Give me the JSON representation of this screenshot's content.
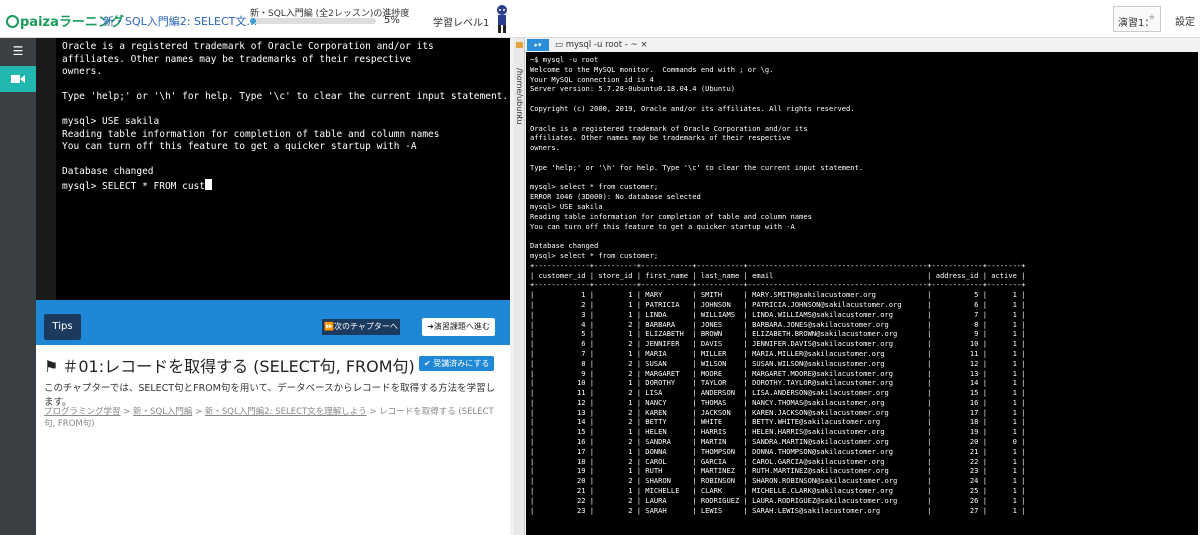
{
  "header": {
    "logo_text": "paizaラーニング",
    "course": "新・SQL入門編2: SELECT文…",
    "progress_label": "新・SQL入門編 (全2レッスン)の進捗度",
    "progress_percent": 5,
    "progress_text": "5%",
    "level_label": "学習レベル1",
    "exercise_button": "演習1：",
    "settings_label": "設定",
    "colors": {
      "accent": "#1e88d6",
      "logo": "#1a9c5b",
      "sidebar": "#3a3f44",
      "active": "#22b8b0"
    }
  },
  "sidebar": {
    "items": [
      {
        "icon": "menu-icon"
      },
      {
        "icon": "video-icon"
      }
    ]
  },
  "left_terminal": {
    "lines": [
      "Oracle is a registered trademark of Oracle Corporation and/or its",
      "affiliates. Other names may be trademarks of their respective",
      "owners.",
      "",
      "Type 'help;' or '\\h' for help. Type '\\c' to clear the current input statement.",
      "",
      "mysql> USE sakila",
      "Reading table information for completion of table and column names",
      "You can turn off this feature to get a quicker startup with -A",
      "",
      "Database changed"
    ],
    "prompt_line": "mysql> SELECT * FROM cust"
  },
  "tips": {
    "tips_label": "Tips",
    "next_chapter": "次のチャプターへ",
    "to_exercise": "演習課題へ進む"
  },
  "chapter": {
    "title": "＃01:レコードを取得する (SELECT句, FROM句)",
    "done_badge": "受講済みにする",
    "description": "このチャプターでは、SELECT句とFROM句を用いて、データベースからレコードを取得する方法を学習します。",
    "breadcrumb": [
      {
        "text": "プログラミング学習",
        "link": true
      },
      {
        "text": "新・SQL入門編",
        "link": true
      },
      {
        "text": "新・SQL入門編2: SELECT文を理解しよう",
        "link": true
      },
      {
        "text": "レコードを取得する (SELECT句, FROM句)",
        "link": false
      }
    ],
    "breadcrumb_separator": ">"
  },
  "right_pane": {
    "vertical_tab": "/home/ubuntu",
    "vertical_tab_close": "×",
    "tab_title": "mysql -u root - ~",
    "tab_close": "×",
    "terminal_lines": [
      "~$ mysql -u root",
      "Welcome to the MySQL monitor.  Commands end with ; or \\g.",
      "Your MySQL connection id is 4",
      "Server version: 5.7.28-0ubuntu0.18.04.4 (Ubuntu)",
      "",
      "Copyright (c) 2000, 2019, Oracle and/or its affiliates. All rights reserved.",
      "",
      "Oracle is a registered trademark of Oracle Corporation and/or its",
      "affiliates. Other names may be trademarks of their respective",
      "owners.",
      "",
      "Type 'help;' or '\\h' for help. Type '\\c' to clear the current input statement.",
      "",
      "mysql> select * from customer;",
      "ERROR 1046 (3D000): No database selected",
      "mysql> USE sakila",
      "Reading table information for completion of table and column names",
      "You can turn off this feature to get a quicker startup with -A",
      "",
      "Database changed",
      "mysql> select * from customer;",
      "+-------------+----------+------------+-----------+------------------------------------------+------------+--------+",
      "| customer_id | store_id | first_name | last_name | email                                    | address_id | active |",
      "+-------------+----------+------------+-----------+------------------------------------------+------------+--------+",
      "|           1 |        1 | MARY       | SMITH     | MARY.SMITH@sakilacustomer.org            |          5 |      1 |",
      "|           2 |        1 | PATRICIA   | JOHNSON   | PATRICIA.JOHNSON@sakilacustomer.org      |          6 |      1 |",
      "|           3 |        1 | LINDA      | WILLIAMS  | LINDA.WILLIAMS@sakilacustomer.org        |          7 |      1 |",
      "|           4 |        2 | BARBARA    | JONES     | BARBARA.JONES@sakilacustomer.org         |          8 |      1 |",
      "|           5 |        1 | ELIZABETH  | BROWN     | ELIZABETH.BROWN@sakilacustomer.org       |          9 |      1 |",
      "|           6 |        2 | JENNIFER   | DAVIS     | JENNIFER.DAVIS@sakilacustomer.org        |         10 |      1 |",
      "|           7 |        1 | MARIA      | MILLER    | MARIA.MILLER@sakilacustomer.org          |         11 |      1 |",
      "|           8 |        2 | SUSAN      | WILSON    | SUSAN.WILSON@sakilacustomer.org          |         12 |      1 |",
      "|           9 |        2 | MARGARET   | MOORE     | MARGARET.MOORE@sakilacustomer.org        |         13 |      1 |",
      "|          10 |        1 | DOROTHY    | TAYLOR    | DOROTHY.TAYLOR@sakilacustomer.org        |         14 |      1 |",
      "|          11 |        2 | LISA       | ANDERSON  | LISA.ANDERSON@sakilacustomer.org         |         15 |      1 |",
      "|          12 |        1 | NANCY      | THOMAS    | NANCY.THOMAS@sakilacustomer.org          |         16 |      1 |",
      "|          13 |        2 | KAREN      | JACKSON   | KAREN.JACKSON@sakilacustomer.org         |         17 |      1 |",
      "|          14 |        2 | BETTY      | WHITE     | BETTY.WHITE@sakilacustomer.org           |         18 |      1 |",
      "|          15 |        1 | HELEN      | HARRIS    | HELEN.HARRIS@sakilacustomer.org          |         19 |      1 |",
      "|          16 |        2 | SANDRA     | MARTIN    | SANDRA.MARTIN@sakilacustomer.org         |         20 |      0 |",
      "|          17 |        1 | DONNA      | THOMPSON  | DONNA.THOMPSON@sakilacustomer.org        |         21 |      1 |",
      "|          18 |        2 | CAROL      | GARCIA    | CAROL.GARCIA@sakilacustomer.org          |         22 |      1 |",
      "|          19 |        1 | RUTH       | MARTINEZ  | RUTH.MARTINEZ@sakilacustomer.org         |         23 |      1 |",
      "|          20 |        2 | SHARON     | ROBINSON  | SHARON.ROBINSON@sakilacustomer.org       |         24 |      1 |",
      "|          21 |        1 | MICHELLE   | CLARK     | MICHELLE.CLARK@sakilacustomer.org        |         25 |      1 |",
      "|          22 |        2 | LAURA      | RODRIGUEZ | LAURA.RODRIGUEZ@sakilacustomer.org       |         26 |      1 |",
      "|          23 |        2 | SARAH      | LEWIS     | SARAH.LEWIS@sakilacustomer.org           |         27 |      1 |"
    ]
  }
}
